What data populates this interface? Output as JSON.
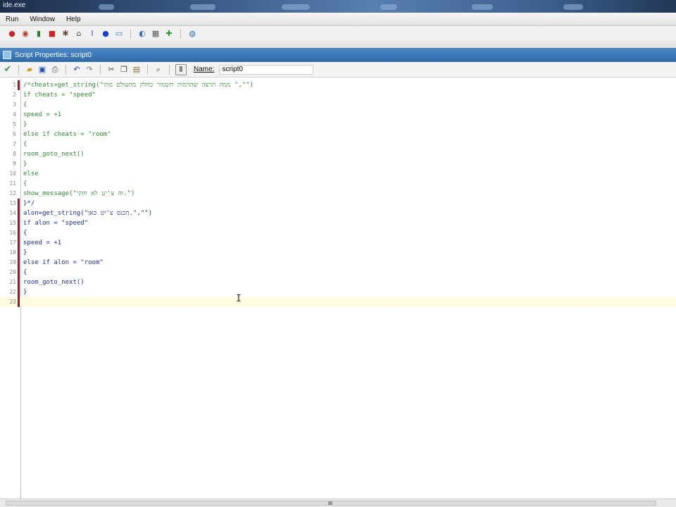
{
  "window": {
    "title": "ide.exe"
  },
  "menu": {
    "items": [
      "Run",
      "Window",
      "Help"
    ]
  },
  "main_toolbar": {
    "icons": [
      "run-icon",
      "debug-icon",
      "pause-icon",
      "stop-icon",
      "clean-icon",
      "create-exe-icon",
      "publish-icon",
      "help-icon",
      "open-icon",
      "sprite-icon",
      "add-icon",
      "info-icon"
    ]
  },
  "properties": {
    "title": "Script Properties: script0"
  },
  "script_toolbar": {
    "name_label": "Name:",
    "name_value": "script0",
    "icons": [
      "ok-check-icon",
      "load-icon",
      "save-icon",
      "print-icon",
      "undo-icon",
      "redo-icon",
      "cut-icon",
      "copy-icon",
      "paste-icon",
      "find-icon",
      "name-field-icon"
    ]
  },
  "editor": {
    "lines": [
      {
        "number": "1",
        "text": "/*cheats=get_string(\"ממה תרצה שהדמות תשמור כחלק מהעולם מתו \",\"\")",
        "style": "comment",
        "changed": true
      },
      {
        "number": "2",
        "text": "if cheats = \"speed\"",
        "style": "comment",
        "changed": false
      },
      {
        "number": "3",
        "text": "{",
        "style": "comment",
        "changed": false
      },
      {
        "number": "4",
        "text": "speed = +1",
        "style": "comment",
        "changed": false
      },
      {
        "number": "5",
        "text": "}",
        "style": "comment",
        "changed": false
      },
      {
        "number": "6",
        "text": "else if cheats = \"room\"",
        "style": "comment",
        "changed": false
      },
      {
        "number": "7",
        "text": "{",
        "style": "comment",
        "changed": false
      },
      {
        "number": "8",
        "text": "room_goto_next()",
        "style": "comment",
        "changed": false
      },
      {
        "number": "9",
        "text": "}",
        "style": "comment",
        "changed": false
      },
      {
        "number": "10",
        "text": "else",
        "style": "comment",
        "changed": false
      },
      {
        "number": "11",
        "text": "{",
        "style": "comment",
        "changed": false
      },
      {
        "number": "12",
        "text": "show_message(\"זה צ'יט לא חוקי.\")",
        "style": "comment",
        "changed": false
      },
      {
        "number": "13",
        "text": "}*/",
        "style": "normal",
        "changed": true
      },
      {
        "number": "14",
        "text": "alon=get_string(\"הכנס צ'יט כאן.\",\"\")",
        "style": "normal",
        "changed": true
      },
      {
        "number": "15",
        "text": "if alon = \"speed\"",
        "style": "normal",
        "changed": true
      },
      {
        "number": "16",
        "text": "{",
        "style": "normal",
        "changed": true
      },
      {
        "number": "17",
        "text": "speed = +1",
        "style": "normal",
        "changed": true
      },
      {
        "number": "18",
        "text": "}",
        "style": "normal",
        "changed": true
      },
      {
        "number": "19",
        "text": "else if alon = \"room\"",
        "style": "normal",
        "changed": true
      },
      {
        "number": "20",
        "text": "{",
        "style": "normal",
        "changed": true
      },
      {
        "number": "21",
        "text": "room_goto_next()",
        "style": "normal",
        "changed": true
      },
      {
        "number": "22",
        "text": "}",
        "style": "normal",
        "changed": true
      },
      {
        "number": "23",
        "text": "",
        "style": "current",
        "changed": true
      }
    ]
  },
  "colors": {
    "comment": "#2f8f2f",
    "code": "#1a2fa0",
    "change_marker": "#8b1e2b",
    "current_line": "#fffbe0",
    "title_bar": "#3a77b8"
  }
}
